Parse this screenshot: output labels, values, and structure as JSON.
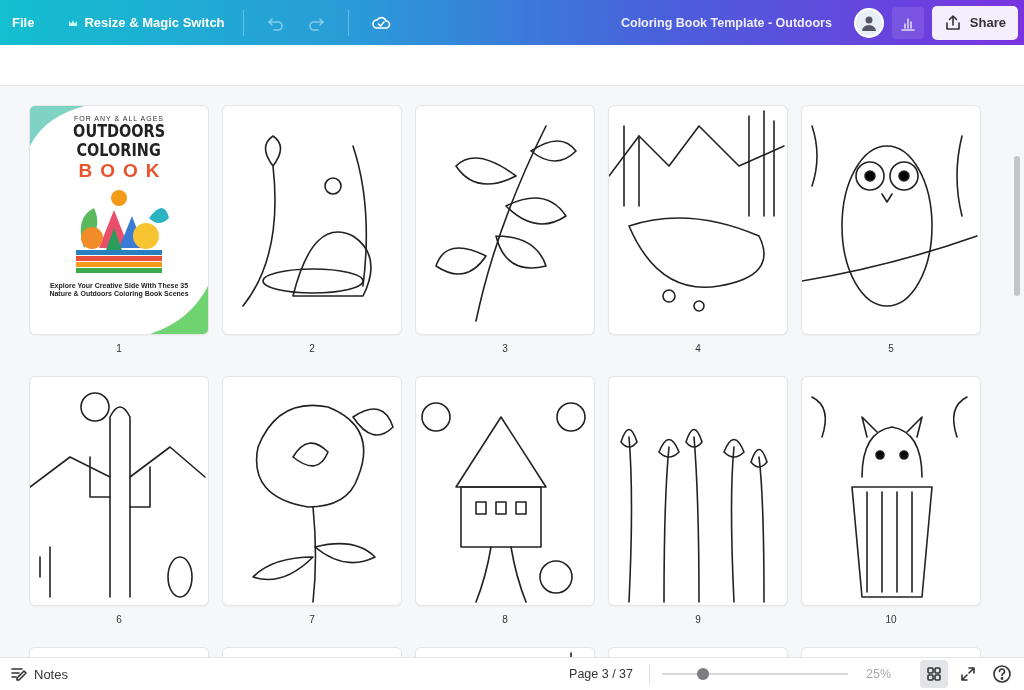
{
  "topbar": {
    "file_menu": "File",
    "resize_button": "Resize & Magic Switch",
    "document_title": "Coloring Book Template - Outdoors",
    "share_button": "Share"
  },
  "pages": [
    {
      "number": "1",
      "kind": "cover",
      "cover": {
        "tagline": "FOR ANY & ALL AGES",
        "title_lines": [
          "OUTDOORS",
          "COLORING"
        ],
        "accent_title": "BOOK",
        "subtitle": "Explore Your Creative Side With These 35 Nature & Outdoors Coloring Book Scenes"
      }
    },
    {
      "number": "2",
      "kind": "drawing"
    },
    {
      "number": "3",
      "kind": "drawing"
    },
    {
      "number": "4",
      "kind": "drawing"
    },
    {
      "number": "5",
      "kind": "drawing"
    },
    {
      "number": "6",
      "kind": "drawing"
    },
    {
      "number": "7",
      "kind": "drawing"
    },
    {
      "number": "8",
      "kind": "drawing"
    },
    {
      "number": "9",
      "kind": "drawing"
    },
    {
      "number": "10",
      "kind": "drawing"
    },
    {
      "kind": "drawing"
    },
    {
      "kind": "drawing"
    },
    {
      "kind": "drawing"
    },
    {
      "kind": "drawing"
    },
    {
      "kind": "drawing"
    }
  ],
  "footer": {
    "notes_button": "Notes",
    "page_indicator": "Page 3 / 37",
    "zoom": {
      "level": 0.22,
      "reading": "25%"
    },
    "grid_view": {
      "selected": true
    }
  }
}
